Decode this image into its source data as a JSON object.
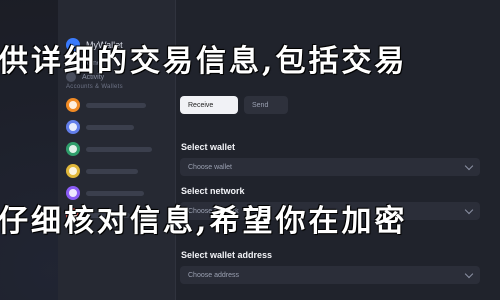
{
  "brand": {
    "name": "MyWallet"
  },
  "sidebar": {
    "nav": [
      {
        "label": "Home"
      },
      {
        "label": "Activity"
      }
    ],
    "section_caption": "Accounts & Wallets",
    "wallets": [
      {
        "color": "#f08a24"
      },
      {
        "color": "#627eea"
      },
      {
        "color": "#2f9e6b"
      },
      {
        "color": "#e0b73a"
      },
      {
        "color": "#8b5cf6"
      },
      {
        "color": "#e2554f"
      }
    ]
  },
  "tabs": {
    "active": "Receive",
    "inactive": "Send"
  },
  "form": {
    "select_wallet_label": "Select wallet",
    "select_wallet_value": "Choose wallet",
    "select_network_label": "Select network",
    "select_network_value": "Choose network",
    "wallet_address_label": "Select wallet address",
    "wallet_address_value": "Choose address"
  },
  "overlay": {
    "line1": "供详细的交易信息,包括交易",
    "line2": "仔细核对信息,希望你在加密"
  },
  "colors": {
    "accent": "#3a7bfd",
    "background": "#1b1d25"
  }
}
